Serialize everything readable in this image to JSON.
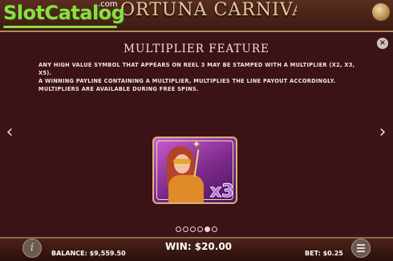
{
  "header": {
    "game_title": "ORTUNA CARNIVALE",
    "logo_text": "SlotCatalog",
    "logo_suffix": ".com"
  },
  "panel": {
    "title": "MULTIPLIER FEATURE",
    "close_label": "×",
    "description": [
      "ANY HIGH VALUE SYMBOL THAT APPEARS ON REEL 3 MAY BE STAMPED WITH A MULTIPLIER (X2, X3, X5).",
      "A WINNING PAYLINE CONTAINING A MULTIPLIER, MULTIPLIES THE LINE PAYOUT ACCORDINGLY.",
      "MULTIPLIERS ARE AVAILABLE DURING FREE SPINS."
    ],
    "nav_prev": "‹",
    "nav_next": "›",
    "symbol_multiplier": "x3"
  },
  "pager": {
    "total_pages": 6,
    "active_page": 5
  },
  "footer": {
    "info_label": "i",
    "balance": "BALANCE: $9,559.50",
    "win": "WIN: $20.00",
    "bet": "BET: $0.25"
  },
  "colors": {
    "panel_bg": "#3b1317",
    "accent_gold": "#d9b27a",
    "logo_green": "#8fdc45",
    "multiplier_purple": "#a85cd6"
  }
}
